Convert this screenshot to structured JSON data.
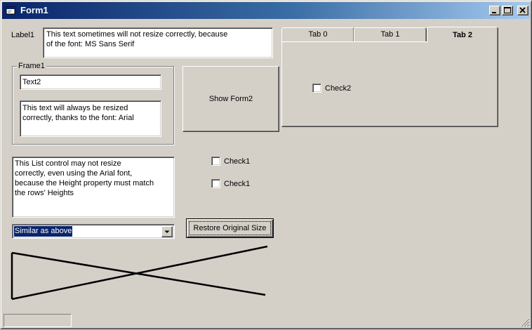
{
  "window": {
    "title": "Form1",
    "minimize_icon": "minimize-icon",
    "maximize_icon": "maximize-icon",
    "close_icon": "close-icon"
  },
  "label1": {
    "caption": "Label1",
    "text": "This text sometimes will not resize correctly, because\nof the font: MS Sans Serif"
  },
  "frame1": {
    "caption": "Frame1",
    "text2": "Text2",
    "memo": "This text will always be resized\ncorrectly, thanks to the font: Arial"
  },
  "show_form2_button": "Show Form2",
  "tabs": {
    "items": [
      "Tab 0",
      "Tab 1",
      "Tab 2"
    ],
    "active": "Tab 2",
    "check2_label": "Check2",
    "check2_checked": false
  },
  "listbox": {
    "items": [
      "This List control may not resize",
      "correctly, even using the Arial font,",
      "because the Height property must match",
      "the rows' Heights"
    ]
  },
  "check1_a": {
    "label": "Check1",
    "checked": false
  },
  "check1_b": {
    "label": "Check1",
    "checked": false
  },
  "combo": {
    "value": "Similar as above"
  },
  "restore_button": "Restore Original Size",
  "colors": {
    "face": "#d4d0c8",
    "title_start": "#0a246a",
    "title_end": "#a6caf0",
    "selection": "#0a246a"
  }
}
